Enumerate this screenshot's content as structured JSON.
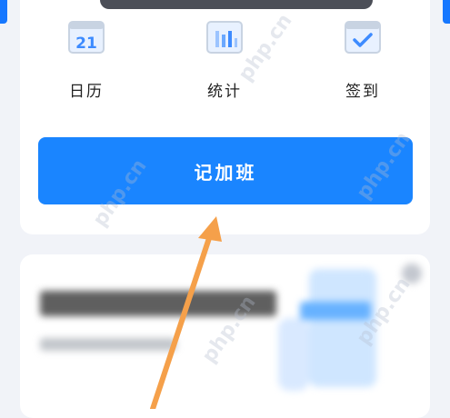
{
  "shortcuts": [
    {
      "label": "日历",
      "icon": "calendar-icon",
      "day": "21"
    },
    {
      "label": "统计",
      "icon": "bar-chart-icon"
    },
    {
      "label": "签到",
      "icon": "checkin-icon"
    }
  ],
  "primary_button": {
    "label": "记加班"
  },
  "colors": {
    "accent": "#1a85ff",
    "arrow": "#f5a04a",
    "icon_blue": "#3d8bff"
  }
}
